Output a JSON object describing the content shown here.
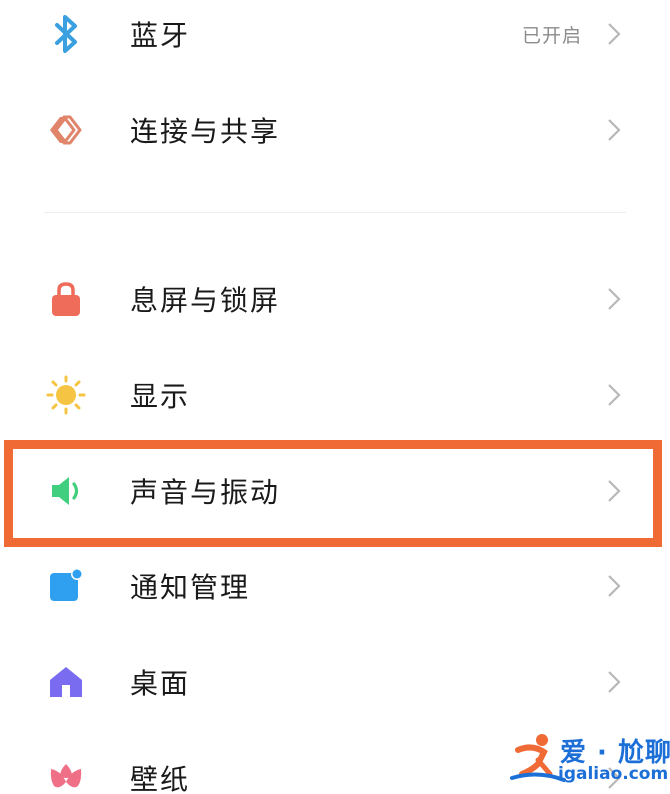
{
  "settings": {
    "items": [
      {
        "label": "蓝牙",
        "value": "已开启",
        "icon": "bluetooth-icon"
      },
      {
        "label": "连接与共享",
        "icon": "connection-share-icon"
      },
      {
        "label": "息屏与锁屏",
        "icon": "lock-icon"
      },
      {
        "label": "显示",
        "icon": "sun-icon"
      },
      {
        "label": "声音与振动",
        "icon": "speaker-icon",
        "highlighted": true
      },
      {
        "label": "通知管理",
        "icon": "notification-icon"
      },
      {
        "label": "桌面",
        "icon": "home-icon"
      },
      {
        "label": "壁纸",
        "icon": "flower-icon"
      }
    ]
  },
  "watermark": {
    "title": "爱 · 尬聊",
    "url": "igaliao.com"
  },
  "colors": {
    "highlight": "#f06a36",
    "bluetooth": "#3aa0e0",
    "connection": "#e0846a",
    "lock": "#ef6b5a",
    "sun": "#f6c443",
    "speaker": "#3fcf7e",
    "notification": "#2f9ff0",
    "home": "#7a6cf0",
    "flower": "#ee6f86",
    "watermark": "#1d6fd8"
  }
}
